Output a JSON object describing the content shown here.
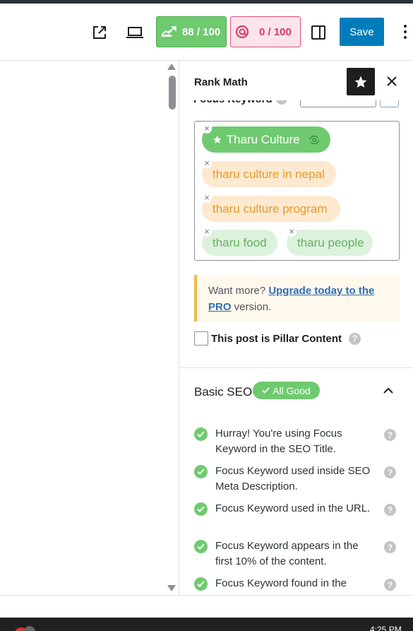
{
  "toolbar": {
    "seo_score": "88 / 100",
    "content_score": "0 / 100",
    "save_label": "Save",
    "icons": [
      "external-link-icon",
      "laptop-preview-icon",
      "sidebar-toggle-icon",
      "more-options-icon"
    ]
  },
  "sidebar": {
    "title": "Rank Math",
    "partial_label": "Focus Keyword",
    "keywords": [
      {
        "label": "Tharu Culture",
        "primary": true
      },
      {
        "label": "tharu culture in nepal",
        "primary": false
      },
      {
        "label": "tharu culture program",
        "primary": false
      },
      {
        "label": "tharu food",
        "primary": false
      },
      {
        "label": "tharu people",
        "primary": false
      }
    ],
    "notice": {
      "prefix": "Want more? ",
      "link": "Upgrade today to the PRO",
      "suffix": " version."
    },
    "pillar_label": "This post is Pillar Content",
    "help_glyph": "?",
    "basic_seo": {
      "title": "Basic SEO",
      "badge": "All Good",
      "checks": [
        "Hurray! You're using Focus Keyword in the SEO Title.",
        "Focus Keyword used inside SEO Meta Description.",
        "Focus Keyword used in the URL.",
        "Focus Keyword appears in the first 10% of the content.",
        "Focus Keyword found in the"
      ]
    }
  },
  "taskbar": {
    "time": "4:25 PM"
  },
  "colors": {
    "accent_blue": "#007cba",
    "seo_green": "#6fca6f",
    "content_pink": "#e24a7f",
    "notice_border": "#f0b849"
  }
}
